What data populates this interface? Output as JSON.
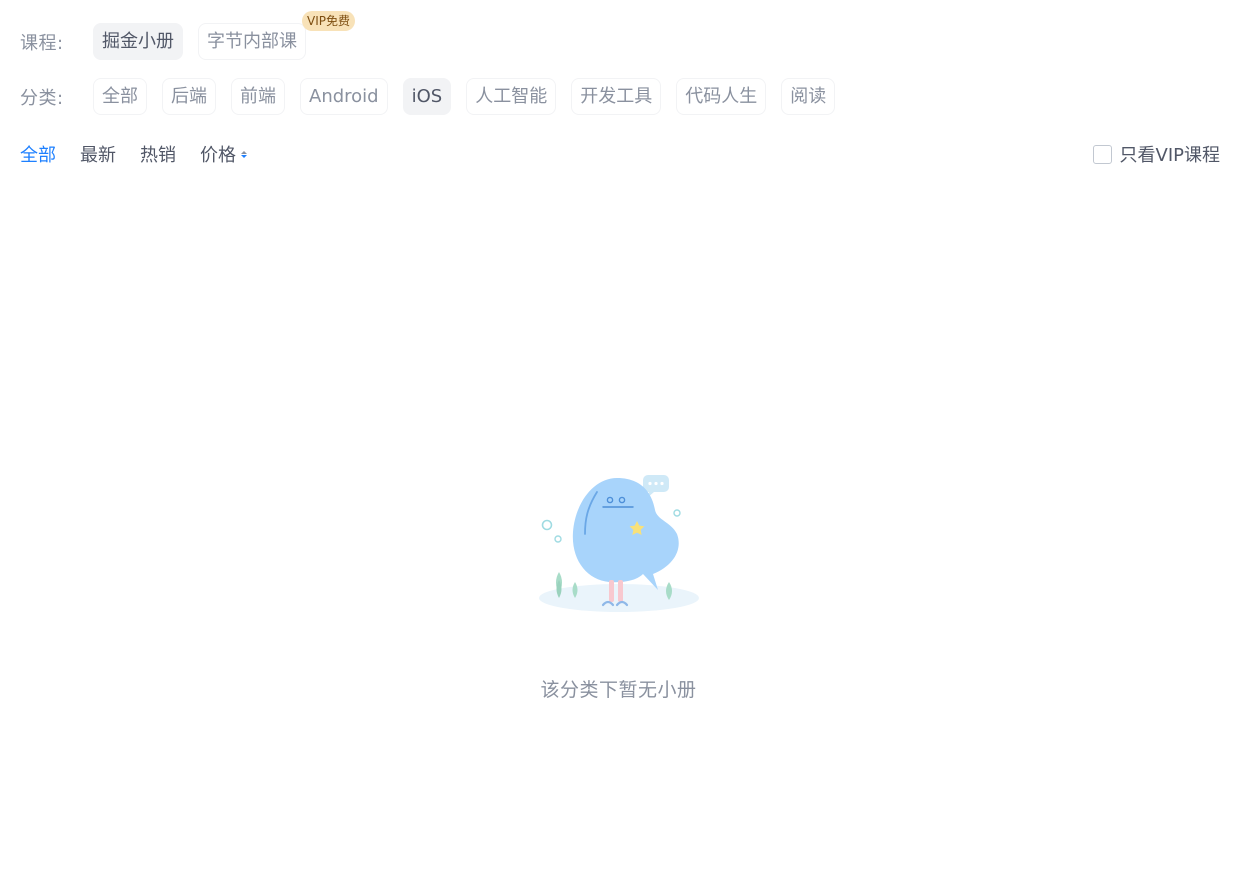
{
  "course": {
    "label": "课程:",
    "chips": [
      {
        "label": "掘金小册",
        "active": true
      },
      {
        "label": "字节内部课",
        "active": false,
        "badge": "VIP免费"
      }
    ]
  },
  "category": {
    "label": "分类:",
    "chips": [
      {
        "label": "全部",
        "active": false
      },
      {
        "label": "后端",
        "active": false
      },
      {
        "label": "前端",
        "active": false
      },
      {
        "label": "Android",
        "active": false
      },
      {
        "label": "iOS",
        "active": true
      },
      {
        "label": "人工智能",
        "active": false
      },
      {
        "label": "开发工具",
        "active": false
      },
      {
        "label": "代码人生",
        "active": false
      },
      {
        "label": "阅读",
        "active": false
      }
    ]
  },
  "sort": {
    "items": [
      {
        "label": "全部",
        "active": true
      },
      {
        "label": "最新",
        "active": false
      },
      {
        "label": "热销",
        "active": false
      },
      {
        "label": "价格",
        "active": false,
        "sortable": true
      }
    ],
    "vip_only_label": "只看VIP课程",
    "vip_only_checked": false
  },
  "empty_state": {
    "icon": "empty-mascot-illustration",
    "message": "该分类下暂无小册"
  },
  "colors": {
    "accent": "#1e80ff",
    "chip_active_bg": "#f2f3f5",
    "badge_bg": "#f8e2b8"
  }
}
